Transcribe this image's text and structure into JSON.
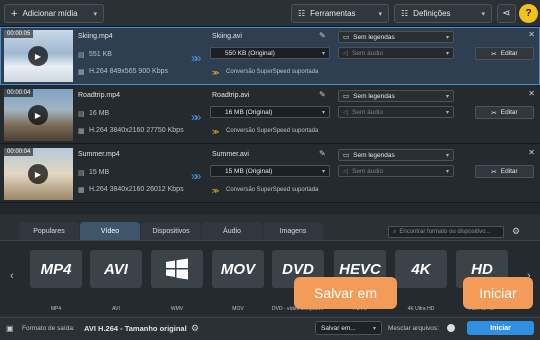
{
  "toolbar": {
    "add_media": "Adicionar mídia",
    "tools": "Ferramentas",
    "settings": "Definições",
    "help": "?"
  },
  "files": [
    {
      "time": "00:00:05",
      "name": "Skiing.mp4",
      "size": "551 KB",
      "info": "H.264 849x565 900 Kbps",
      "out_name": "Skiing.avi",
      "out_size": "550 KB (Original)",
      "conversion": "Conversão SuperSpeed suportada",
      "subtitles": "Sem legendas",
      "audio": "Sem áudio",
      "edit": "Editar"
    },
    {
      "time": "00:00:04",
      "name": "Roadtrip.mp4",
      "size": "16 MB",
      "info": "H.264 3840x2160 27750 Kbps",
      "out_name": "Roadtrip.avi",
      "out_size": "16 MB (Original)",
      "conversion": "Conversão SuperSpeed suportada",
      "subtitles": "Sem legendas",
      "audio": "Sem áudio",
      "edit": "Editar"
    },
    {
      "time": "00:00:04",
      "name": "Summer.mp4",
      "size": "15 MB",
      "info": "H.264 3840x2160 26012 Kbps",
      "out_name": "Summer.avi",
      "out_size": "15 MB (Original)",
      "conversion": "Conversão SuperSpeed suportada",
      "subtitles": "Sem legendas",
      "audio": "Sem áudio",
      "edit": "Editar"
    }
  ],
  "tabs": [
    "Populares",
    "Vídeo",
    "Dispositivos",
    "Áudio",
    "Imagens"
  ],
  "search_placeholder": "Encontrar formato ou dispositivo...",
  "formats": [
    {
      "logo": "MP4",
      "label": "MP4"
    },
    {
      "logo": "AVI",
      "label": "AVI"
    },
    {
      "logo": "",
      "label": "WMV"
    },
    {
      "logo": "MOV",
      "label": "MOV"
    },
    {
      "logo": "DVD",
      "label": "DVD - vídeo compatível"
    },
    {
      "logo": "HEVC",
      "label": "HEVC"
    },
    {
      "logo": "4K",
      "label": "4K Ultra HD"
    },
    {
      "logo": "HD",
      "label": "HD/Full HD"
    }
  ],
  "status": {
    "output_label": "Formato de saída:",
    "output_value": "AVI H.264 - Tamanho original",
    "save_in": "Salvar em...",
    "merge": "Mesclar arquivos:",
    "start": "Iniciar"
  },
  "callouts": {
    "save": "Salvar em",
    "start": "Iniciar"
  },
  "colors": {
    "accent": "#2f8fe3",
    "callout": "#f39c5a"
  }
}
